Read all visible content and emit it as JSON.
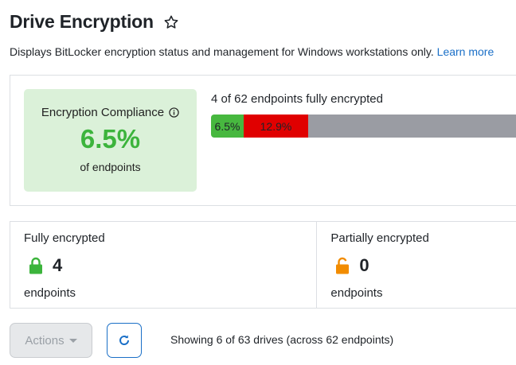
{
  "page": {
    "title": "Drive Encryption",
    "subtitle": "Displays BitLocker encryption status and management for Windows workstations only.",
    "learn_more": "Learn more"
  },
  "compliance": {
    "label": "Encryption Compliance",
    "percent": "6.5%",
    "unit": "of endpoints",
    "caption": "4 of 62 endpoints fully encrypted",
    "segments": [
      {
        "label": "6.5%",
        "fraction": 0.065,
        "color": "#47b83f"
      },
      {
        "label": "12.9%",
        "fraction": 0.129,
        "color": "#e00000"
      },
      {
        "label": "",
        "fraction": 0.806,
        "color": "#9a9ca3"
      }
    ]
  },
  "stats": {
    "fully": {
      "label": "Fully encrypted",
      "value": "4",
      "unit": "endpoints",
      "icon": "lock-closed-icon",
      "color": "#3cb43c"
    },
    "partial": {
      "label": "Partially encrypted",
      "value": "0",
      "unit": "endpoints",
      "icon": "lock-open-icon",
      "color": "#f28c00"
    }
  },
  "toolbar": {
    "actions_label": "Actions",
    "showing": "Showing 6 of 63 drives (across 62 endpoints)"
  }
}
